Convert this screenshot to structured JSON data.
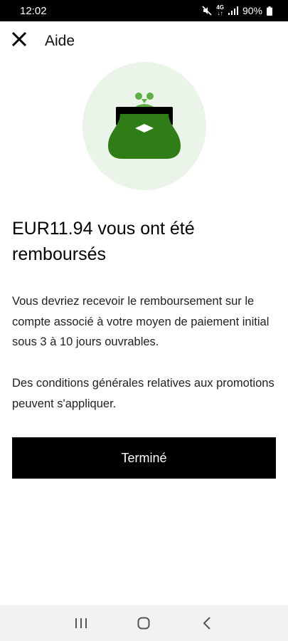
{
  "status_bar": {
    "time": "12:02",
    "network_top": "4G",
    "network_bottom": "↓↑",
    "battery_percent": "90%"
  },
  "header": {
    "title": "Aide",
    "close_icon": "close-icon"
  },
  "hero": {
    "icon": "coin-purse-icon",
    "circle_color": "#eaf4e8",
    "purse_color": "#2e7d16",
    "clasp_color": "#000000",
    "knob_color": "#5fae46"
  },
  "refund": {
    "title": "EUR11.94 vous ont été remboursés",
    "body": "Vous devriez recevoir le remboursement sur le compte associé à votre moyen de paiement initial sous 3 à 10 jours ouvrables.",
    "terms": "Des conditions générales relatives aux promotions peuvent s'appliquer.",
    "done_label": "Terminé"
  },
  "nav_bar": {
    "recents_icon": "recents-icon",
    "home_icon": "home-icon",
    "back_icon": "back-icon"
  }
}
